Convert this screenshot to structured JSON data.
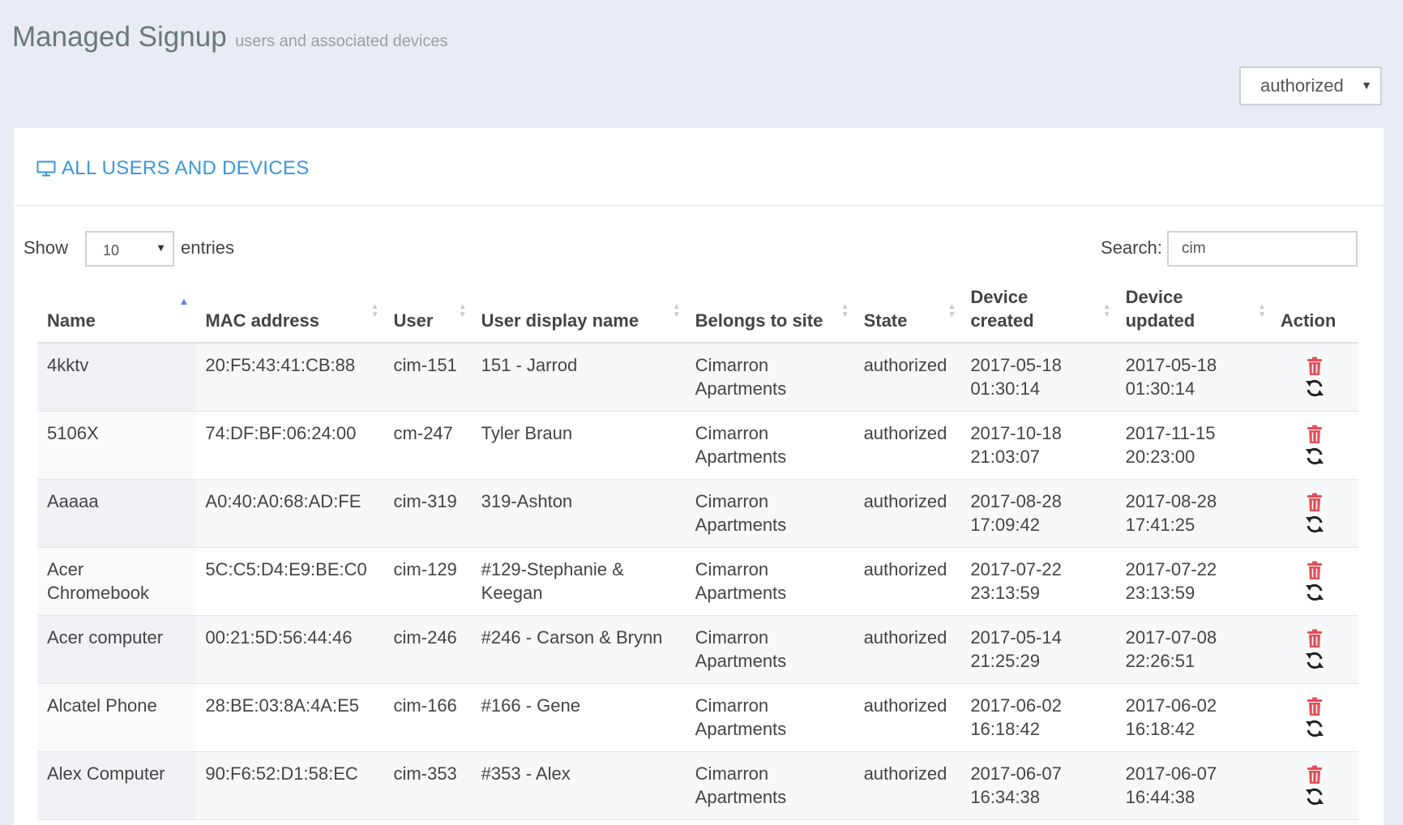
{
  "header": {
    "title": "Managed Signup",
    "subtitle": "users and associated devices"
  },
  "filter": {
    "selected": "authorized"
  },
  "panel": {
    "caption": "ALL USERS AND DEVICES",
    "icon": "monitor-icon"
  },
  "length": {
    "show_label": "Show",
    "value": "10",
    "entries_label": "entries"
  },
  "search": {
    "label": "Search:",
    "value": "cim"
  },
  "columns": [
    "Name",
    "MAC address",
    "User",
    "User display name",
    "Belongs to site",
    "State",
    "Device created",
    "Device updated",
    "Action"
  ],
  "sorted_column": "Name",
  "rows": [
    {
      "name": "4kktv",
      "mac": "20:F5:43:41:CB:88",
      "user": "cim-151",
      "display": "151 - Jarrod",
      "site": "Cimarron Apartments",
      "state": "authorized",
      "created": "2017-05-18 01:30:14",
      "updated": "2017-05-18 01:30:14"
    },
    {
      "name": "5106X",
      "mac": "74:DF:BF:06:24:00",
      "user": "cm-247",
      "display": "Tyler Braun",
      "site": "Cimarron Apartments",
      "state": "authorized",
      "created": "2017-10-18 21:03:07",
      "updated": "2017-11-15 20:23:00"
    },
    {
      "name": "Aaaaa",
      "mac": "A0:40:A0:68:AD:FE",
      "user": "cim-319",
      "display": "319-Ashton",
      "site": "Cimarron Apartments",
      "state": "authorized",
      "created": "2017-08-28 17:09:42",
      "updated": "2017-08-28 17:41:25"
    },
    {
      "name": "Acer Chromebook",
      "mac": "5C:C5:D4:E9:BE:C0",
      "user": "cim-129",
      "display": "#129-Stephanie & Keegan",
      "site": "Cimarron Apartments",
      "state": "authorized",
      "created": "2017-07-22 23:13:59",
      "updated": "2017-07-22 23:13:59"
    },
    {
      "name": "Acer computer",
      "mac": "00:21:5D:56:44:46",
      "user": "cim-246",
      "display": "#246 - Carson & Brynn",
      "site": "Cimarron Apartments",
      "state": "authorized",
      "created": "2017-05-14 21:25:29",
      "updated": "2017-07-08 22:26:51"
    },
    {
      "name": "Alcatel Phone",
      "mac": "28:BE:03:8A:4A:E5",
      "user": "cim-166",
      "display": "#166 - Gene",
      "site": "Cimarron Apartments",
      "state": "authorized",
      "created": "2017-06-02 16:18:42",
      "updated": "2017-06-02 16:18:42"
    },
    {
      "name": "Alex Computer",
      "mac": "90:F6:52:D1:58:EC",
      "user": "cim-353",
      "display": "#353 - Alex",
      "site": "Cimarron Apartments",
      "state": "authorized",
      "created": "2017-06-07 16:34:38",
      "updated": "2017-06-07 16:44:38"
    }
  ],
  "colors": {
    "accent": "#3a97d8",
    "delete": "#e0505a",
    "sort_active": "#6f7ed8"
  }
}
